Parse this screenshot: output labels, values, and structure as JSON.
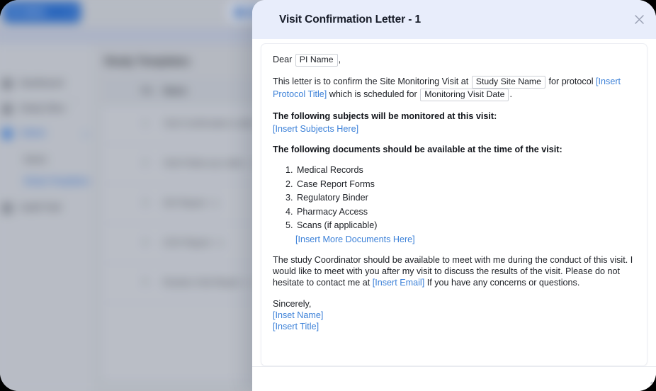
{
  "background": {
    "topbar": {
      "logo_label": "wbste",
      "logo_caret": "▾",
      "avatar_button": "account-menu"
    },
    "sidebar": {
      "collapse_icon": "‹",
      "items": [
        {
          "label": "Dashboard",
          "icon": "dashboard-icon",
          "active": false
        },
        {
          "label": "Study Sites",
          "icon": "sites-icon",
          "active": false
        },
        {
          "label": "Admin",
          "icon": "admin-icon",
          "active": true,
          "expand_icon": "▴"
        }
      ],
      "subitems": [
        {
          "label": "Users",
          "active": false
        },
        {
          "label": "Study Templates",
          "active": true
        }
      ],
      "footer_items": [
        {
          "label": "Audit Trail",
          "icon": "audit-icon",
          "active": false
        }
      ]
    },
    "main": {
      "page_title": "Study Templates",
      "table": {
        "columns": [
          "No.",
          "Name"
        ],
        "rows": [
          {
            "no": "1",
            "name": "Visit Confirmation Letter - 1"
          },
          {
            "no": "2",
            "name": "Visit Follow-up Letter - 1"
          },
          {
            "no": "3",
            "name": "SIV Report - 1"
          },
          {
            "no": "4",
            "name": "COV Report - 1"
          },
          {
            "no": "5",
            "name": "Routine Visit Report - 1"
          }
        ]
      }
    }
  },
  "modal": {
    "title": "Visit Confirmation Letter - 1",
    "close_icon": "close-icon",
    "resize_handle": "resize-grip",
    "letter": {
      "salutation_prefix": "Dear",
      "salutation_tag": "PI Name",
      "salutation_suffix": ",",
      "intro_part1": "This letter is to confirm the Site Monitoring Visit at",
      "intro_tag_site": "Study Site Name",
      "intro_part2": "for protocol",
      "intro_protocol_placeholder": "[Insert Protocol Title]",
      "intro_part3": "which is scheduled for",
      "intro_tag_date": "Monitoring Visit Date",
      "intro_part4": ".",
      "subjects_heading": "The following subjects will be monitored at this visit:",
      "subjects_placeholder": "[Insert Subjects Here]",
      "documents_heading": "The following documents should be available at the time of the visit:",
      "documents_list": [
        "Medical Records",
        "Case Report Forms",
        "Regulatory Binder",
        "Pharmacy Access",
        "Scans (if applicable)"
      ],
      "documents_more_placeholder": "[Insert More Documents Here]",
      "closing_part1": "The study Coordinator should be available to meet with me during the conduct of this visit. I would like to meet with you after my visit to discuss the results of the visit. Please do not hesitate to contact me at",
      "closing_email_placeholder": "[Insert Email]",
      "closing_part2": "If you have any concerns or questions.",
      "sign_off": "Sincerely,",
      "sign_name_placeholder": "[Inset Name]",
      "sign_title_placeholder": "[Insert Title]"
    }
  },
  "colors": {
    "modal_header_bg": "#e8edfb",
    "placeholder_blue": "#3c81d8",
    "brand_blue": "#1b63c9",
    "active_nav_blue": "#2f6fd0"
  }
}
